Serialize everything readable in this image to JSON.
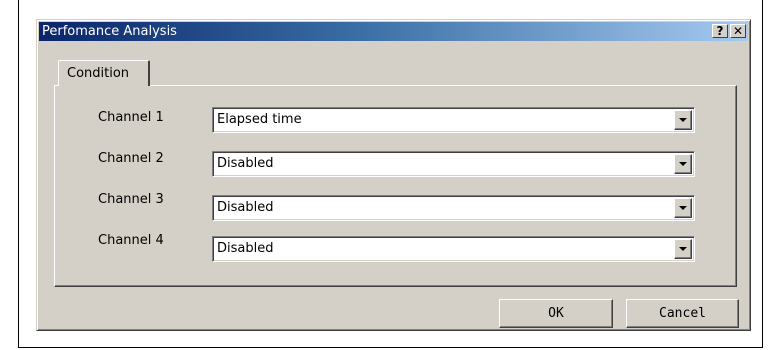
{
  "window": {
    "title": "Perfomance Analysis",
    "help_glyph": "?",
    "close_glyph": "✕"
  },
  "tabs": [
    {
      "label": "Condition",
      "selected": true
    }
  ],
  "channels": [
    {
      "label": "Channel 1",
      "value": "Elapsed time"
    },
    {
      "label": "Channel 2",
      "value": "Disabled"
    },
    {
      "label": "Channel 3",
      "value": "Disabled"
    },
    {
      "label": "Channel 4",
      "value": "Disabled"
    }
  ],
  "buttons": {
    "ok_label": "OK",
    "cancel_label": "Cancel"
  },
  "colors": {
    "titlebar_start": "#0a246a",
    "titlebar_end": "#a6caf0",
    "face": "#d4d0c8"
  },
  "icons": {
    "help": "help-icon",
    "close": "close-icon",
    "dropdown": "chevron-down-icon"
  }
}
